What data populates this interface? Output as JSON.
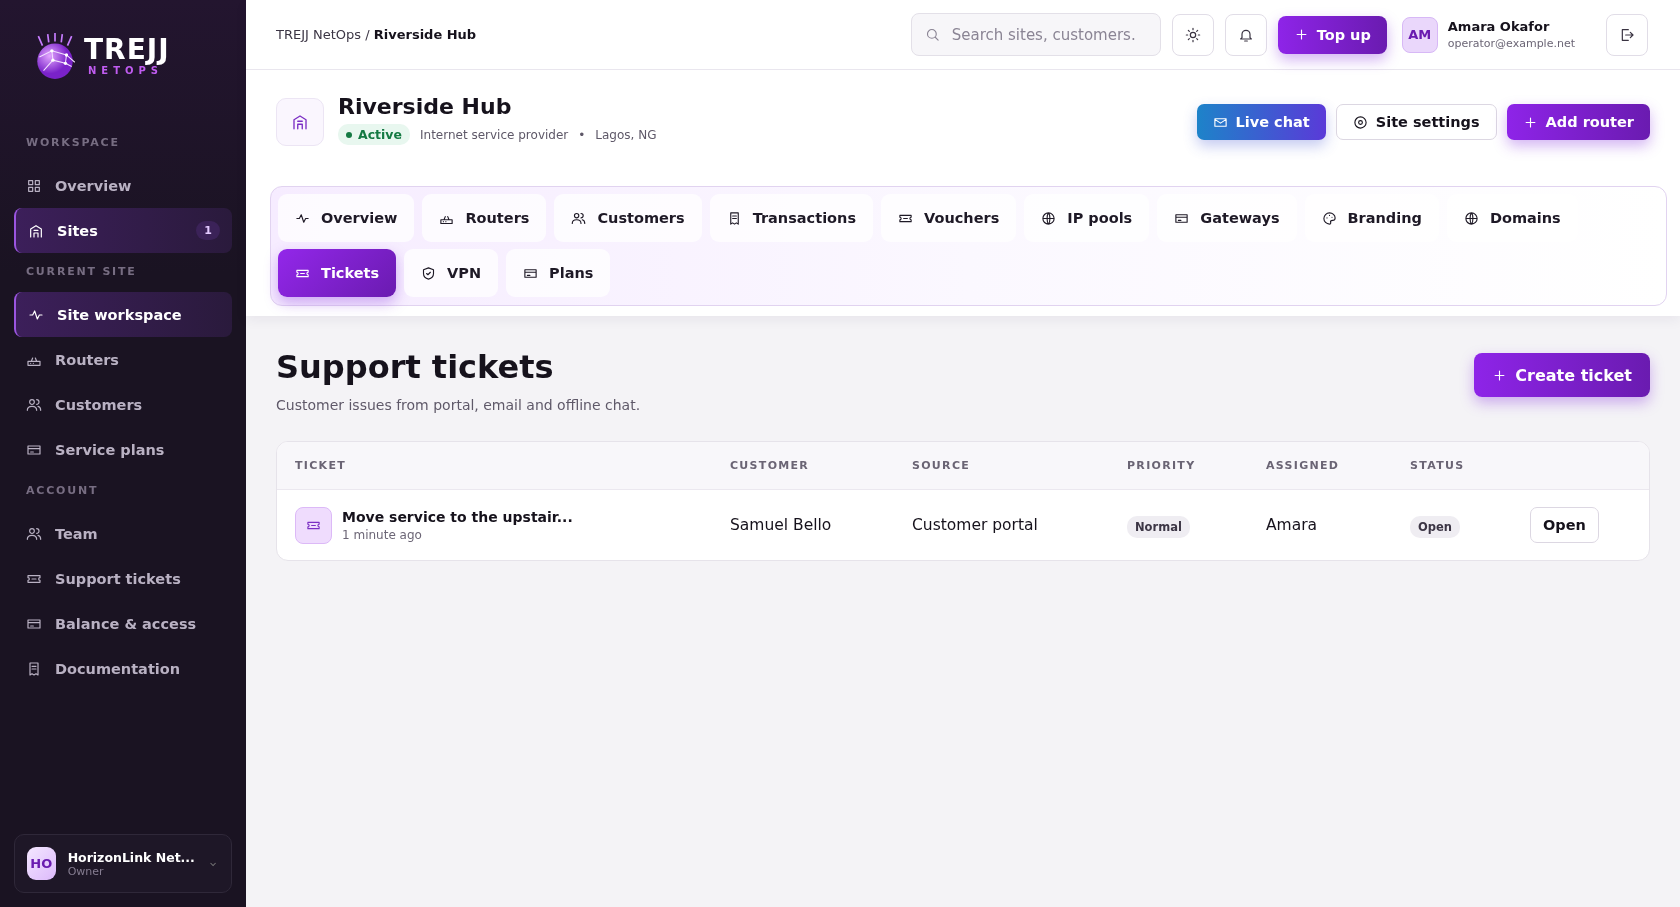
{
  "brand": {
    "name": "TREJJ",
    "sub": "NETOPS"
  },
  "sidebar": {
    "sections": [
      {
        "label": "WORKSPACE",
        "items": [
          {
            "label": "Overview",
            "selected": false
          },
          {
            "label": "Sites",
            "selected": true,
            "badge": "1"
          }
        ]
      },
      {
        "label": "CURRENT SITE",
        "items": [
          {
            "label": "Site workspace",
            "selected": true
          },
          {
            "label": "Routers",
            "selected": false
          },
          {
            "label": "Customers",
            "selected": false
          },
          {
            "label": "Service plans",
            "selected": false
          }
        ]
      },
      {
        "label": "ACCOUNT",
        "items": [
          {
            "label": "Team",
            "selected": false
          },
          {
            "label": "Support tickets",
            "selected": false
          },
          {
            "label": "Balance & access",
            "selected": false
          },
          {
            "label": "Documentation",
            "selected": false
          }
        ]
      }
    ],
    "account": {
      "initials": "HO",
      "name": "HorizonLink Net...",
      "role": "Owner"
    }
  },
  "topbar": {
    "breadcrumb": [
      "TREJJ NetOps",
      "/",
      "Riverside Hub"
    ],
    "search": {
      "placeholder": "Search sites, customers."
    },
    "top_up": "Top up",
    "user": {
      "initials": "AM",
      "name": "Amara Okafor",
      "email": "operator@example.net"
    }
  },
  "site": {
    "name": "Riverside Hub",
    "status": "Active",
    "type": "Internet service provider",
    "separator": "•",
    "location": "Lagos, NG",
    "buttons": [
      {
        "label": "Live chat",
        "kind": "chat"
      },
      {
        "label": "Site settings",
        "kind": "settings"
      },
      {
        "label": "Add router",
        "kind": "add"
      }
    ]
  },
  "tabs": [
    {
      "label": "Overview",
      "selected": false
    },
    {
      "label": "Routers",
      "selected": false
    },
    {
      "label": "Customers",
      "selected": false
    },
    {
      "label": "Transactions",
      "selected": false
    },
    {
      "label": "Vouchers",
      "selected": false
    },
    {
      "label": "IP pools",
      "selected": false
    },
    {
      "label": "Gateways",
      "selected": false
    },
    {
      "label": "Branding",
      "selected": false
    },
    {
      "label": "Domains",
      "selected": false
    },
    {
      "label": "Tickets",
      "selected": true
    },
    {
      "label": "VPN",
      "selected": false
    },
    {
      "label": "Plans",
      "selected": false
    }
  ],
  "page": {
    "title": "Support tickets",
    "subtitle": "Customer issues from portal, email and offline chat.",
    "create_button": "Create ticket"
  },
  "table": {
    "columns": [
      "TICKET",
      "CUSTOMER",
      "SOURCE",
      "PRIORITY",
      "ASSIGNED",
      "STATUS"
    ],
    "rows": [
      {
        "title": "Move service to the upstair...",
        "time": "1 minute ago",
        "customer": "Samuel Bello",
        "source": "Customer portal",
        "priority": "Normal",
        "assigned": "Amara",
        "status": "Open",
        "action": "Open"
      }
    ]
  }
}
